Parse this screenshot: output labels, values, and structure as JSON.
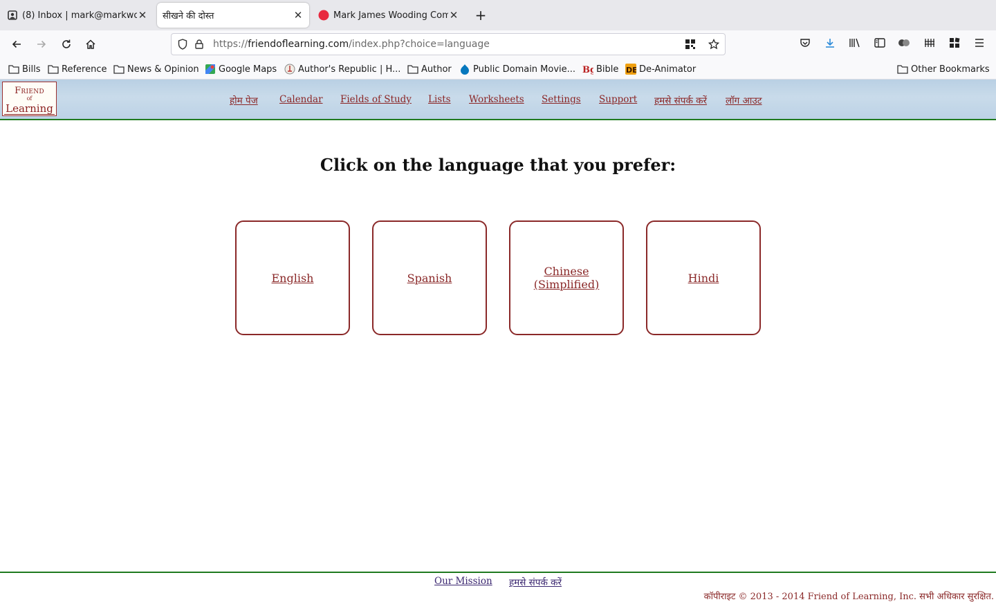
{
  "tabs": [
    {
      "title": "(8) Inbox | mark@markwo",
      "icon": "mail-icon"
    },
    {
      "title": "सीखने की दोस्त",
      "icon": "none"
    },
    {
      "title": "Mark James Wooding Com",
      "icon": "red-dot-icon"
    }
  ],
  "url": {
    "scheme": "https://",
    "host": "friendoflearning.com",
    "path": "/index.php?choice=language"
  },
  "bookmarks": [
    {
      "label": "Bills",
      "icon": "folder-icon"
    },
    {
      "label": "Reference",
      "icon": "folder-icon"
    },
    {
      "label": "News & Opinion",
      "icon": "folder-icon"
    },
    {
      "label": "Google Maps",
      "icon": "maps-icon"
    },
    {
      "label": "Author's Republic | H...",
      "icon": "author-icon"
    },
    {
      "label": "Author",
      "icon": "folder-icon"
    },
    {
      "label": "Public Domain Movie...",
      "icon": "drupal-icon"
    },
    {
      "label": "Bible",
      "icon": "bible-icon"
    },
    {
      "label": "De-Animator",
      "icon": "de-icon"
    }
  ],
  "other_bookmarks": "Other Bookmarks",
  "logo": {
    "line1": "Friend",
    "line2": "of",
    "line3": "Learning"
  },
  "site_nav": [
    "होम पेज",
    "Calendar",
    "Fields of Study",
    "Lists",
    "Worksheets",
    "Settings",
    "Support",
    "हमसे संपर्क करें",
    "लॉग आउट"
  ],
  "heading": "Click on the language that you prefer:",
  "languages": [
    "English",
    "Spanish",
    "Chinese (Simplified)",
    "Hindi"
  ],
  "footer": {
    "links": [
      "Our Mission",
      "हमसे संपर्क करें"
    ],
    "copyright": "कॉपीराइट © 2013 - 2014 Friend of Learning, Inc. सभी अधिकार सुरक्षित."
  },
  "colors": {
    "accent": "#8a2828",
    "header_rule": "#1f7a1f",
    "header_bg": "#c3d7e9"
  }
}
